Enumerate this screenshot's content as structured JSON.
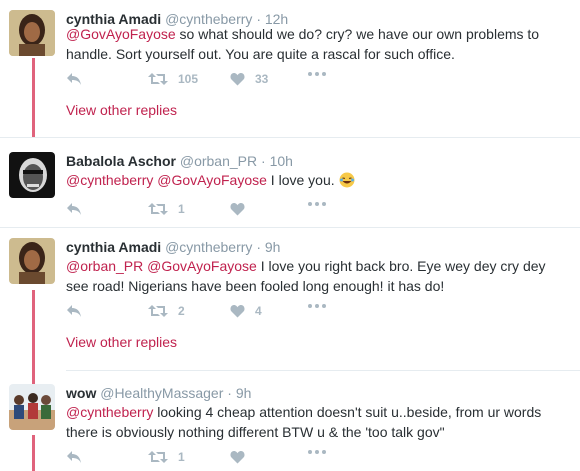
{
  "tweets": [
    {
      "name": "cynthia Amadi",
      "handle": "@cyntheberry",
      "time": "· 12h",
      "mentions": [
        "@GovAyoFayose"
      ],
      "text": " so what should we do? cry? we have our own problems to handle. Sort yourself out. You are quite a rascal for such office.",
      "retweets": "105",
      "likes": "33",
      "view_replies": "View other replies"
    },
    {
      "name": "Babalola Aschor",
      "handle": "@orban_PR",
      "time": "· 10h",
      "mentions": [
        "@cyntheberry",
        "@GovAyoFayose"
      ],
      "text": " I love you. ",
      "retweets": "1",
      "likes": ""
    },
    {
      "name": "cynthia Amadi",
      "handle": "@cyntheberry",
      "time": "· 9h",
      "mentions": [
        "@orban_PR",
        "@GovAyoFayose"
      ],
      "text": " I love you right back bro. Eye wey dey cry dey see road! Nigerians have been fooled long enough! it has do!",
      "retweets": "2",
      "likes": "4",
      "view_replies": "View other replies"
    },
    {
      "name": "wow",
      "handle": "@HealthyMassager",
      "time": "· 9h",
      "mentions": [
        "@cyntheberry"
      ],
      "text": " looking 4 cheap attention doesn't suit u..beside, from ur words there is obviously nothing different BTW u & the 'too talk gov\"",
      "retweets": "1",
      "likes": ""
    }
  ],
  "colors": {
    "accent": "#c0224e",
    "thread_line": "#e0637c",
    "muted": "#8899a6",
    "icon": "#aab8c2"
  },
  "icons": [
    "reply-icon",
    "retweet-icon",
    "like-icon",
    "more-icon",
    "laughing-emoji-icon"
  ]
}
